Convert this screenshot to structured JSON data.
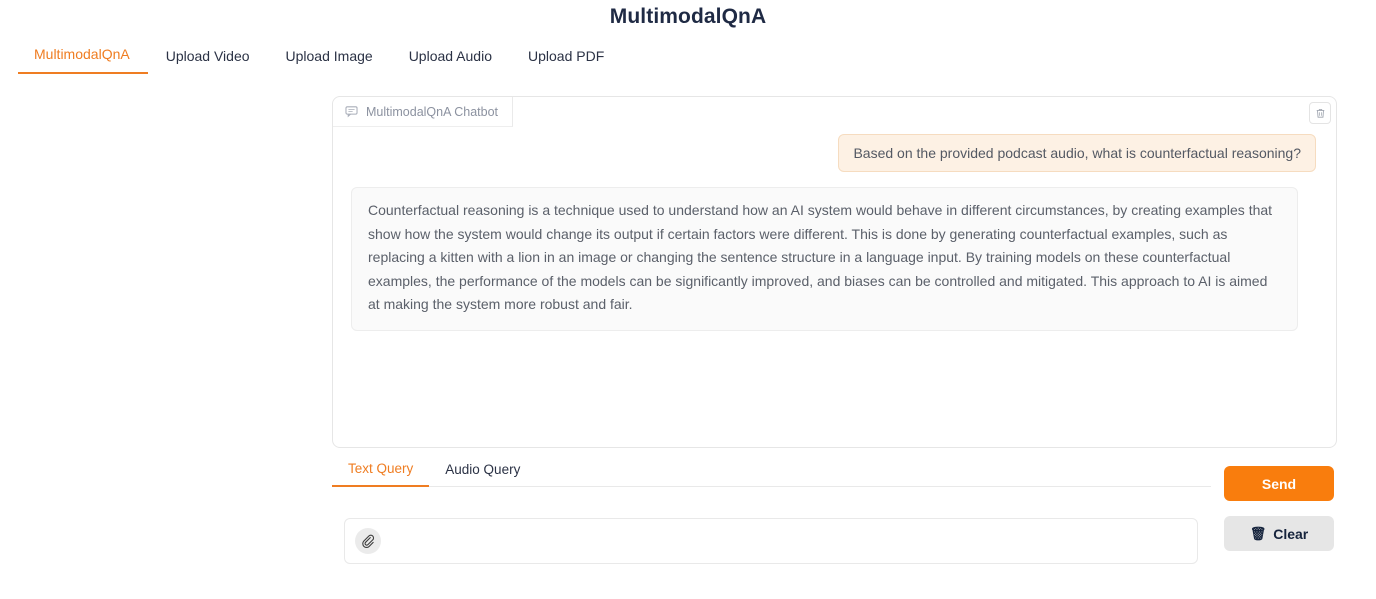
{
  "app": {
    "title": "MultimodalQnA"
  },
  "top_nav": {
    "items": [
      {
        "label": "MultimodalQnA",
        "active": true
      },
      {
        "label": "Upload Video",
        "active": false
      },
      {
        "label": "Upload Image",
        "active": false
      },
      {
        "label": "Upload Audio",
        "active": false
      },
      {
        "label": "Upload PDF",
        "active": false
      }
    ]
  },
  "chat_panel": {
    "header": {
      "icon": "chat-bubble-icon",
      "label": "MultimodalQnA Chatbot"
    },
    "clear_chat_icon": "trash-icon",
    "messages": [
      {
        "role": "user",
        "text": "Based on the provided podcast audio, what is counterfactual reasoning?"
      },
      {
        "role": "assistant",
        "text": "Counterfactual reasoning is a technique used to understand how an AI system would behave in different circumstances, by creating examples that show how the system would change its output if certain factors were different. This is done by generating counterfactual examples, such as replacing a kitten with a lion in an image or changing the sentence structure in a language input. By training models on these counterfactual examples, the performance of the models can be significantly improved, and biases can be controlled and mitigated. This approach to AI is aimed at making the system more robust and fair."
      }
    ]
  },
  "query_tabs": {
    "items": [
      {
        "label": "Text Query",
        "active": true
      },
      {
        "label": "Audio Query",
        "active": false
      }
    ]
  },
  "input": {
    "attach_icon": "paperclip-icon",
    "value": "",
    "placeholder": ""
  },
  "actions": {
    "send_label": "Send",
    "clear_label": "Clear",
    "clear_icon": "wastebasket-icon",
    "clear_glyph": "🗑"
  },
  "colors": {
    "accent": "#ef7d22",
    "send_button": "#f97d0d",
    "user_bubble_bg": "#fdf1e4",
    "user_bubble_border": "#f6dcc0",
    "bot_bubble_bg": "#fafafa",
    "title": "#1f2a44"
  }
}
